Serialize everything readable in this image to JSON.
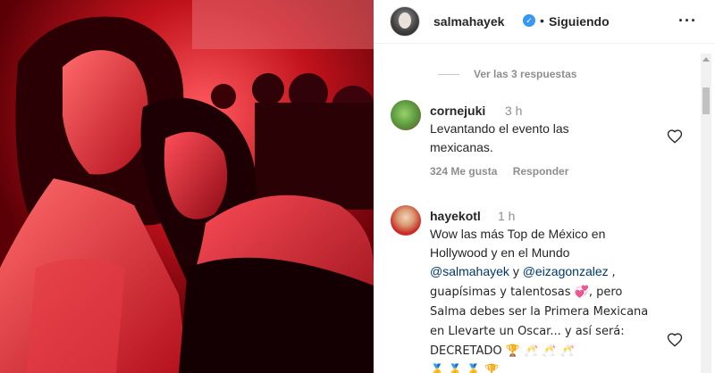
{
  "post": {
    "author": "salmahayek",
    "verified_badge": "✓",
    "separator": "•",
    "follow_state": "Siguiendo",
    "more_icon": "more-horizontal-icon"
  },
  "replies": {
    "label": "Ver las 3 respuestas"
  },
  "comments": [
    {
      "user": "cornejuki",
      "time": "3 h",
      "text": "Levantando el evento las mexicanas.",
      "likes": "324 Me gusta",
      "reply_label": "Responder"
    },
    {
      "user": "hayekotl",
      "time": "1 h",
      "text_part1": "Wow las más Top de México en Hollywood y en el Mundo",
      "mention1": "@salmahayek",
      "connector": "y",
      "mention2": "@eizagonzalez",
      "text_part2": ", guapísimas y talentosas 💞, pero Salma debes ser la Primera Mexicana en Llevarte un Oscar... y así será: DECRETADO 🏆 🥂 🥂 🥂",
      "text_part3": "🥇 🥇 🥇 🏆"
    }
  ],
  "colors": {
    "link": "#00376b",
    "muted": "#8e8e8e",
    "verified": "#3897f0",
    "photo_red": "#c10012"
  }
}
